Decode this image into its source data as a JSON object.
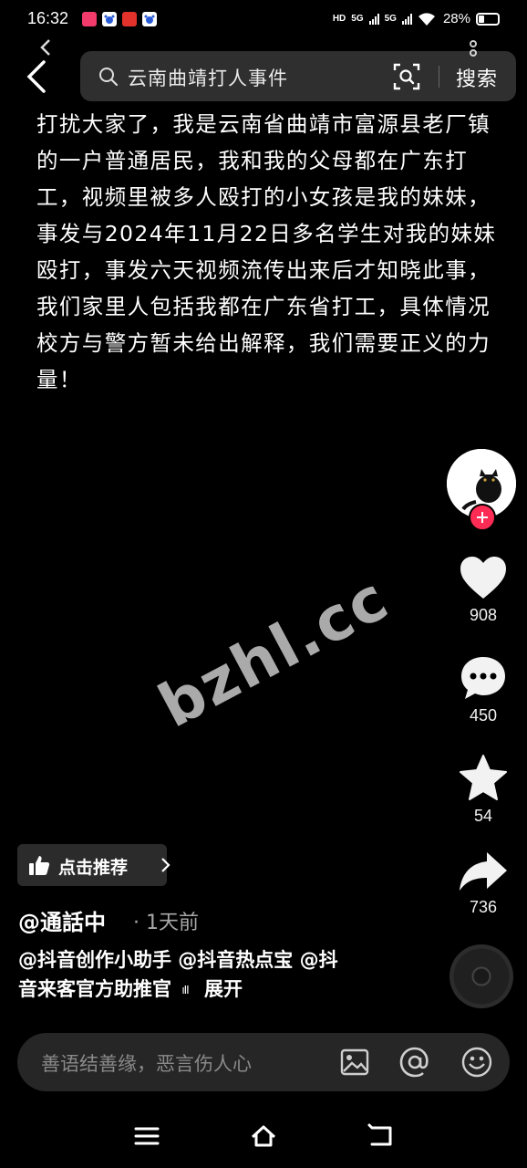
{
  "status_bar": {
    "time": "16:32",
    "network_1": "HD",
    "network_2": "5G",
    "network_3": "5G",
    "battery": "28%"
  },
  "search": {
    "query": "云南曲靖打人事件",
    "button_label": "搜索"
  },
  "video": {
    "description": "打扰大家了，我是云南省曲靖市富源县老厂镇的一户普通居民，我和我的父母都在广东打工，视频里被多人殴打的小女孩是我的妹妹，事发与2024年11月22日多名学生对我的妹妹殴打，事发六天视频流传出来后才知晓此事，我们家里人包括我都在广东省打工，具体情况校方与警方暂未给出解释，我们需要正义的力量！",
    "author": "@通話中",
    "post_time": "· 1天前",
    "tags_line1": "@抖音创作小助手 @抖音热点宝 @抖",
    "tags_line2": "音来客官方助推官",
    "sound_indicator": "ıII",
    "expand_label": "展开",
    "recommend_label": "点击推荐",
    "watermark": "bzhl.cc"
  },
  "actions": {
    "likes": "908",
    "comments": "450",
    "favorites": "54",
    "shares": "736"
  },
  "comment_bar": {
    "placeholder": "善语结善缘，恶言伤人心"
  },
  "colors": {
    "background": "#000000",
    "follow_accent": "#fe2c55",
    "search_bg": "#2f2f2f",
    "comment_bg": "#262626"
  }
}
